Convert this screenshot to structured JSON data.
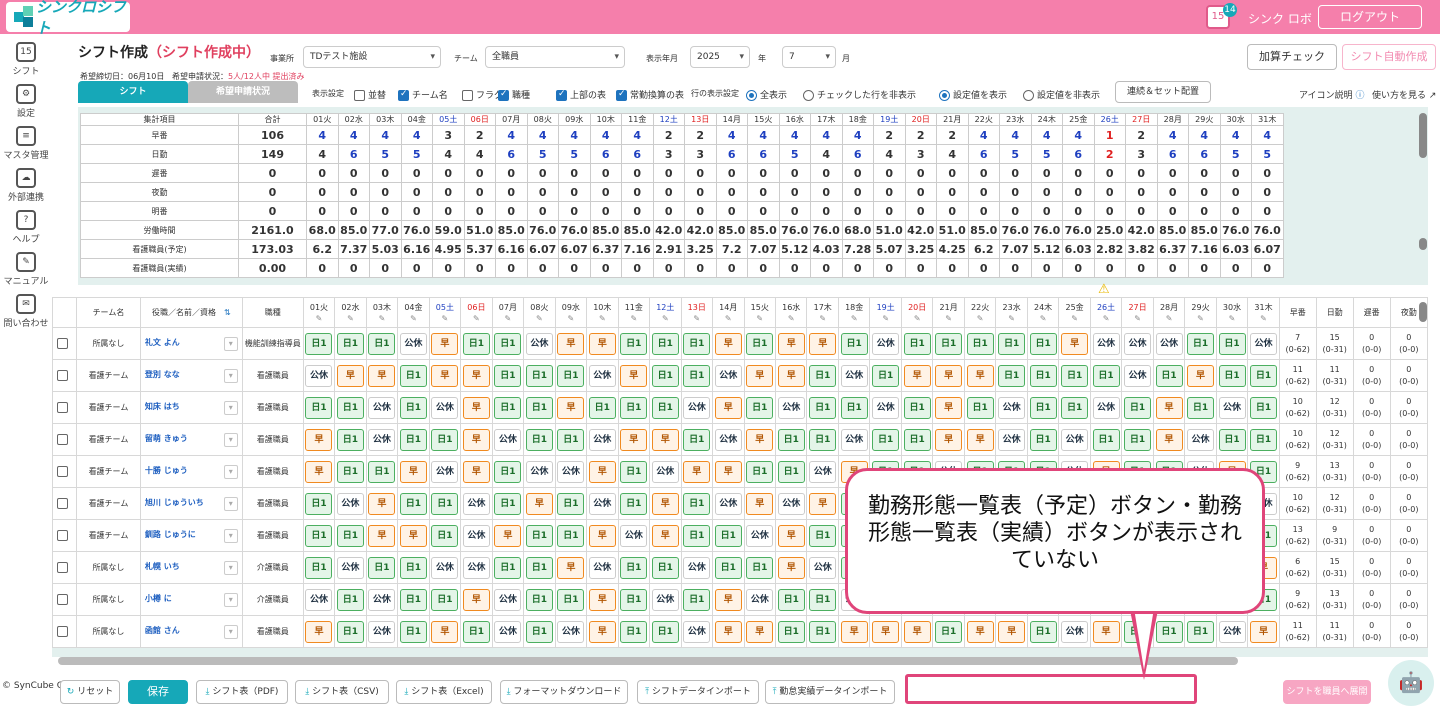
{
  "app": {
    "logo": "シンクロシフト",
    "badge": "14",
    "cal_day": "15",
    "user": "シンク ロボ",
    "logout": "ログアウト"
  },
  "sidebar": [
    {
      "label": "シフト",
      "icon": "calendar-icon",
      "g": "15"
    },
    {
      "label": "設定",
      "icon": "gear-icon",
      "g": "⚙"
    },
    {
      "label": "マスタ管理",
      "icon": "database-icon",
      "g": "≡"
    },
    {
      "label": "外部連携",
      "icon": "cloud-icon",
      "g": "☁"
    },
    {
      "label": "ヘルプ",
      "icon": "help-icon",
      "g": "?"
    },
    {
      "label": "マニュアル",
      "icon": "manual-icon",
      "g": "✎"
    },
    {
      "label": "問い合わせ",
      "icon": "mail-icon",
      "g": "✉"
    }
  ],
  "copyright": "© SynCube Co., Ltd.",
  "page": {
    "title": "シフト作成",
    "status": "（シフト作成中）",
    "deadline": "希望締切日：06月10日",
    "request_status": "希望申請状況：",
    "request_count": "5人/12人中 提出済み"
  },
  "filters": {
    "office_label": "事業所",
    "office": "TDテスト施設",
    "team_label": "チーム",
    "team": "全職員",
    "ym_label": "表示年月",
    "year": "2025",
    "year_unit": "年",
    "month": "7",
    "month_unit": "月"
  },
  "actions": {
    "calc_check": "加算チェック",
    "auto_create": "シフト自動作成"
  },
  "tabs": {
    "shift": "シフト",
    "request": "希望申請状況"
  },
  "display": {
    "label": "表示設定",
    "opts": [
      {
        "t": "並替",
        "on": false
      },
      {
        "t": "チーム名",
        "on": true
      },
      {
        "t": "フラグ",
        "on": false
      },
      {
        "t": "職種",
        "on": true
      },
      {
        "t": "上部の表",
        "on": true
      },
      {
        "t": "常勤換算の表",
        "on": true
      }
    ],
    "row_label": "行の表示設定",
    "all": "全表示",
    "hide_checked": "チェックした行を非表示",
    "show_set": "設定値を表示",
    "hide_set": "設定値を非表示",
    "link_btn": "連続＆セット配置",
    "icon_help": "アイコン説明",
    "how_to": "使い方を見る"
  },
  "days": [
    "01火",
    "02水",
    "03木",
    "04金",
    "05土",
    "06日",
    "07月",
    "08火",
    "09水",
    "10木",
    "11金",
    "12土",
    "13日",
    "14月",
    "15火",
    "16水",
    "17木",
    "18金",
    "19土",
    "20日",
    "21月",
    "22火",
    "23水",
    "24木",
    "25金",
    "26土",
    "27日",
    "28月",
    "29火",
    "30水",
    "31木"
  ],
  "summary": {
    "hdr": "集計項目",
    "total_hdr": "合計",
    "rows": [
      {
        "label": "早番",
        "total": "106",
        "vals": [
          "4",
          "4",
          "4",
          "4",
          "3",
          "2",
          "4",
          "4",
          "4",
          "4",
          "4",
          "2",
          "2",
          "4",
          "4",
          "4",
          "4",
          "4",
          "2",
          "2",
          "2",
          "4",
          "4",
          "4",
          "4",
          "1",
          "2",
          "4",
          "4",
          "4",
          "4"
        ]
      },
      {
        "label": "日勤",
        "total": "149",
        "vals": [
          "4",
          "6",
          "5",
          "5",
          "4",
          "4",
          "6",
          "5",
          "5",
          "6",
          "6",
          "3",
          "3",
          "6",
          "6",
          "5",
          "4",
          "6",
          "4",
          "3",
          "4",
          "6",
          "5",
          "5",
          "6",
          "2",
          "3",
          "6",
          "6",
          "5",
          "5"
        ]
      },
      {
        "label": "遅番",
        "total": "0",
        "vals": [
          "0",
          "0",
          "0",
          "0",
          "0",
          "0",
          "0",
          "0",
          "0",
          "0",
          "0",
          "0",
          "0",
          "0",
          "0",
          "0",
          "0",
          "0",
          "0",
          "0",
          "0",
          "0",
          "0",
          "0",
          "0",
          "0",
          "0",
          "0",
          "0",
          "0",
          "0"
        ]
      },
      {
        "label": "夜勤",
        "total": "0",
        "vals": [
          "0",
          "0",
          "0",
          "0",
          "0",
          "0",
          "0",
          "0",
          "0",
          "0",
          "0",
          "0",
          "0",
          "0",
          "0",
          "0",
          "0",
          "0",
          "0",
          "0",
          "0",
          "0",
          "0",
          "0",
          "0",
          "0",
          "0",
          "0",
          "0",
          "0",
          "0"
        ]
      },
      {
        "label": "明番",
        "total": "0",
        "vals": [
          "0",
          "0",
          "0",
          "0",
          "0",
          "0",
          "0",
          "0",
          "0",
          "0",
          "0",
          "0",
          "0",
          "0",
          "0",
          "0",
          "0",
          "0",
          "0",
          "0",
          "0",
          "0",
          "0",
          "0",
          "0",
          "0",
          "0",
          "0",
          "0",
          "0",
          "0"
        ]
      },
      {
        "label": "労働時間",
        "total": "2161.0",
        "vals": [
          "68.0",
          "85.0",
          "77.0",
          "76.0",
          "59.0",
          "51.0",
          "85.0",
          "76.0",
          "76.0",
          "85.0",
          "85.0",
          "42.0",
          "42.0",
          "85.0",
          "85.0",
          "76.0",
          "76.0",
          "68.0",
          "51.0",
          "42.0",
          "51.0",
          "85.0",
          "76.0",
          "76.0",
          "76.0",
          "25.0",
          "42.0",
          "85.0",
          "85.0",
          "76.0",
          "76.0"
        ]
      },
      {
        "label": "看護職員(予定)",
        "total": "173.03",
        "vals": [
          "6.2",
          "7.37",
          "5.03",
          "6.16",
          "4.95",
          "5.37",
          "6.16",
          "6.07",
          "6.07",
          "6.37",
          "7.16",
          "2.91",
          "3.25",
          "7.2",
          "7.07",
          "5.12",
          "4.03",
          "7.28",
          "5.07",
          "3.25",
          "4.25",
          "6.2",
          "7.07",
          "5.12",
          "6.03",
          "2.82",
          "3.82",
          "6.37",
          "7.16",
          "6.03",
          "6.07"
        ]
      },
      {
        "label": "看護職員(実績)",
        "total": "0.00",
        "vals": [
          "0",
          "0",
          "0",
          "0",
          "0",
          "0",
          "0",
          "0",
          "0",
          "0",
          "0",
          "0",
          "0",
          "0",
          "0",
          "0",
          "0",
          "0",
          "0",
          "0",
          "0",
          "0",
          "0",
          "0",
          "0",
          "0",
          "0",
          "0",
          "0",
          "0",
          "0"
        ]
      }
    ]
  },
  "grid": {
    "team_hdr": "チーム名",
    "role_hdr": "役職／名前／資格",
    "job_hdr": "職種",
    "count_hdrs": [
      "早番",
      "日勤",
      "遅番",
      "夜勤"
    ],
    "rows": [
      {
        "team": "所属なし",
        "name": "礼文 よん",
        "job": "機能訓練指導員",
        "shifts": "NNNHENNHEENNNENEENHNNNNNEHHHNNHH",
        "c": [
          "7",
          "15",
          "0",
          "0"
        ],
        "r": [
          "(0-62)",
          "(0-31)",
          "(0-0)",
          "(0-0)"
        ]
      },
      {
        "team": "看護チーム",
        "name": "登別 なな",
        "job": "看護職員",
        "shifts": "HEENEENNNHENNHEENHNEEENNNNHNENNN",
        "c": [
          "11",
          "11",
          "0",
          "0"
        ],
        "r": [
          "(0-62)",
          "(0-31)",
          "(0-0)",
          "(0-0)"
        ]
      },
      {
        "team": "看護チーム",
        "name": "知床 はち",
        "job": "看護職員",
        "shifts": "NNHNHENNENNNHENHNNHNENHNNHNENHNE",
        "c": [
          "10",
          "12",
          "0",
          "0"
        ],
        "r": [
          "(0-62)",
          "(0-31)",
          "(0-0)",
          "(0-0)"
        ]
      },
      {
        "team": "看護チーム",
        "name": "留萌 きゅう",
        "job": "看護職員",
        "shifts": "ENHNNEHNNHEENHENNHNNEEHNHNNEHNN",
        "c": [
          "10",
          "12",
          "0",
          "0"
        ],
        "r": [
          "(0-62)",
          "(0-31)",
          "(0-0)",
          "(0-0)"
        ]
      },
      {
        "team": "看護チーム",
        "name": "十勝 じゅう",
        "job": "看護職員",
        "shifts": "ENNEHENHHENHEENNHENNHNNNHENNHEN",
        "c": [
          "9",
          "13",
          "0",
          "0"
        ],
        "r": [
          "(0-62)",
          "(0-31)",
          "(0-0)",
          "(0-0)"
        ]
      },
      {
        "team": "看護チーム",
        "name": "旭川 じゅういち",
        "job": "看護職員",
        "shifts": "NHENNHNENHNENHEHENNHEENHNEHNENH",
        "c": [
          "10",
          "12",
          "0",
          "0"
        ],
        "r": [
          "(0-62)",
          "(0-31)",
          "(0-0)",
          "(0-0)"
        ]
      },
      {
        "team": "看護チーム",
        "name": "釧路 じゅうに",
        "job": "看護職員",
        "shifts": "NNEENHENNEHENNHENNNHHENEHNNHENN",
        "c": [
          "13",
          "9",
          "0",
          "0"
        ],
        "r": [
          "(0-62)",
          "(0-31)",
          "(0-0)",
          "(0-0)"
        ]
      },
      {
        "team": "所属なし",
        "name": "札幌 いち",
        "job": "介護職員",
        "shifts": "NHNNHHNNEHNNHNNEHNNHNENNHENHNNE",
        "c": [
          "6",
          "15",
          "0",
          "0"
        ],
        "r": [
          "(0-62)",
          "(0-31)",
          "(0-0)",
          "(0-0)"
        ]
      },
      {
        "team": "所属なし",
        "name": "小樽 に",
        "job": "介護職員",
        "shifts": "HNHNNEHNNENHNEHNNHENHNNENHNNHEN",
        "c": [
          "9",
          "13",
          "0",
          "0"
        ],
        "r": [
          "(0-62)",
          "(0-31)",
          "(0-0)",
          "(0-0)"
        ]
      },
      {
        "team": "所属なし",
        "name": "函館 さん",
        "job": "看護職員",
        "shifts": "ENHNENHNHENNHEENNEEENEENHENNNHE",
        "c": [
          "11",
          "11",
          "0",
          "0"
        ],
        "r": [
          "(0-62)",
          "(0-31)",
          "(0-0)",
          "(0-0)"
        ]
      }
    ]
  },
  "shift_labels": {
    "N": "日1",
    "H": "公休",
    "E": "早"
  },
  "bottom": {
    "reset": "リセット",
    "save": "保存",
    "pdf": "シフト表（PDF)",
    "csv": "シフト表（CSV)",
    "excel": "シフト表（Excel)",
    "format": "フォーマットダウンロード",
    "import": "シフトデータインポート",
    "attendance": "勤怠実績データインポート",
    "publish": "シフトを職員へ展開"
  },
  "callout": "勤務形態一覧表（予定）ボタン・勤務形態一覧表（実績）ボタンが表示されていない",
  "colors": {
    "brand_pink": "#f57fab",
    "teal": "#16a8b8",
    "callout": "#e0457a"
  }
}
